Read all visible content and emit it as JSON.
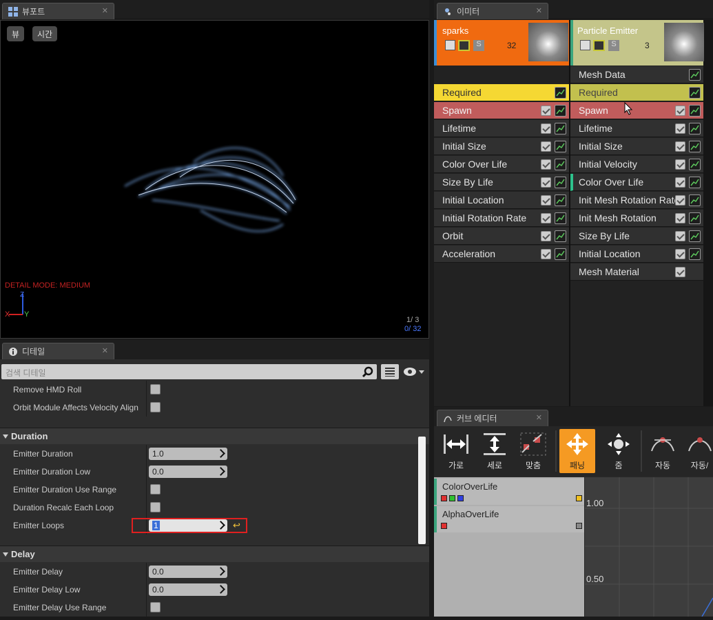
{
  "viewport": {
    "tab": "뷰포트",
    "btn_view": "뷰",
    "btn_time": "시간",
    "detail_mode": "DETAIL MODE: MEDIUM",
    "axis_x": "X",
    "axis_y": "Y",
    "axis_z": "Z",
    "stat_top": "1/ 3",
    "stat_bottom": "0/ 32"
  },
  "emitter": {
    "tab": "이미터",
    "emitters": [
      {
        "name": "sparks",
        "count": "32",
        "solo": "S",
        "color": "#f06a10"
      },
      {
        "name": "Particle Emitter",
        "count": "3",
        "solo": "S",
        "color": "#c4c58a"
      }
    ],
    "col1": [
      "Required",
      "Spawn",
      "Lifetime",
      "Initial Size",
      "Color Over Life",
      "Size By Life",
      "Initial Location",
      "Initial Rotation Rate",
      "Orbit",
      "Acceleration"
    ],
    "col2": [
      "Mesh Data",
      "Required",
      "Spawn",
      "Lifetime",
      "Initial Size",
      "Initial Velocity",
      "Color Over Life",
      "Init Mesh Rotation Rate",
      "Init Mesh Rotation",
      "Size By Life",
      "Initial Location",
      "Mesh Material"
    ]
  },
  "details": {
    "tab": "디테일",
    "search_placeholder": "검색 디테일",
    "rows_top": [
      "Remove HMD Roll",
      "Orbit Module Affects Velocity Align"
    ],
    "cat_duration": "Duration",
    "duration_rows": {
      "emitter_duration": {
        "label": "Emitter Duration",
        "value": "1.0"
      },
      "emitter_duration_low": {
        "label": "Emitter Duration Low",
        "value": "0.0"
      },
      "use_range": {
        "label": "Emitter Duration Use Range"
      },
      "recalc": {
        "label": "Duration Recalc Each Loop"
      },
      "loops": {
        "label": "Emitter Loops",
        "value": "1"
      }
    },
    "cat_delay": "Delay",
    "delay_rows": {
      "delay": {
        "label": "Emitter Delay",
        "value": "0.0"
      },
      "delay_low": {
        "label": "Emitter Delay Low",
        "value": "0.0"
      },
      "delay_use_range": {
        "label": "Emitter Delay Use Range"
      }
    }
  },
  "curve": {
    "tab": "커브 에디터",
    "toolbar": [
      "가로",
      "세로",
      "맞춤",
      "패닝",
      "줌",
      "자동",
      "자동/"
    ],
    "tracks": [
      "ColorOverLife",
      "AlphaOverLife"
    ],
    "y_labels": [
      "1.00",
      "0.50"
    ]
  },
  "colors": {
    "accent": "#f59a23",
    "highlight_border": "#e02020",
    "teal": "#3ba57d"
  }
}
